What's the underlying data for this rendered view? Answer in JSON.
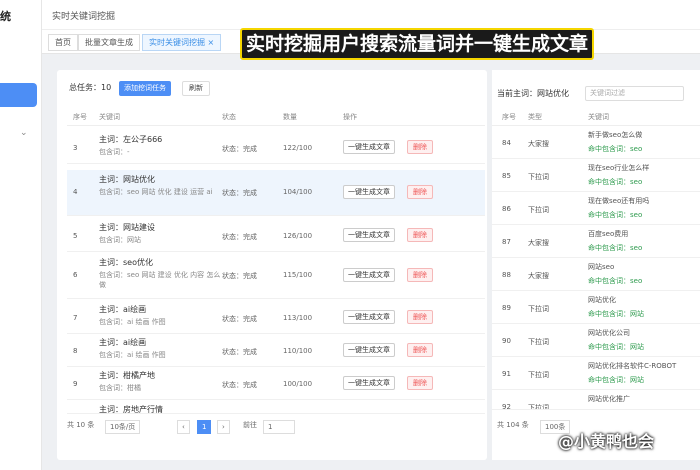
{
  "sidebar": {
    "brand": "统"
  },
  "topbar": {
    "breadcrumb": "实时关键词挖掘"
  },
  "tabs": [
    {
      "label": "首页"
    },
    {
      "label": "批量文章生成"
    },
    {
      "label": "实时关键词挖掘 ×"
    }
  ],
  "banner": "实时挖掘用户搜索流量词并一键生成文章",
  "left": {
    "total_label": "总任务：10",
    "add_button": "添加挖词任务",
    "refresh_button": "刷新",
    "headers": [
      "序号",
      "关键词",
      "状态",
      "数量",
      "操作"
    ],
    "rows": [
      {
        "seq": "3",
        "main": "主词：左公子666",
        "sub": "包含词：-",
        "status": "状态：完成",
        "count": "122/100"
      },
      {
        "seq": "4",
        "main": "主词：网站优化",
        "sub": "包含词：seo 网站 优化 建设 运营 ai",
        "status": "状态：完成",
        "count": "104/100"
      },
      {
        "seq": "5",
        "main": "主词：网站建设",
        "sub": "包含词：网站",
        "status": "状态：完成",
        "count": "126/100"
      },
      {
        "seq": "6",
        "main": "主词：seo优化",
        "sub": "包含词：seo 网站 建设 优化 内容 怎么做",
        "status": "状态：完成",
        "count": "115/100"
      },
      {
        "seq": "7",
        "main": "主词：ai绘画",
        "sub": "包含词：ai 绘画 作图",
        "status": "状态：完成",
        "count": "113/100"
      },
      {
        "seq": "8",
        "main": "主词：ai绘画",
        "sub": "包含词：ai 绘画 作图",
        "status": "状态：完成",
        "count": "110/100"
      },
      {
        "seq": "9",
        "main": "主词：柑橘产地",
        "sub": "包含词：柑橘",
        "status": "状态：完成",
        "count": "100/100"
      },
      {
        "seq": "",
        "main": "主词：房地产行情",
        "sub": "",
        "status": "",
        "count": ""
      }
    ],
    "gen_button": "一键生成文章",
    "del_button": "删除",
    "pager": {
      "total": "共 10 条",
      "per_page": "10条/页",
      "page": "1",
      "goto": "前往",
      "goto_value": "1"
    }
  },
  "right": {
    "current_label": "当前主词：网站优化",
    "filter_placeholder": "关键词过滤",
    "headers": [
      "序号",
      "类型",
      "关键词"
    ],
    "rows": [
      {
        "seq": "84",
        "type": "大家搜",
        "kw": "新手做seo怎么做",
        "hit": "命中包含词：seo"
      },
      {
        "seq": "85",
        "type": "下拉词",
        "kw": "现在seo行业怎么样",
        "hit": "命中包含词：seo"
      },
      {
        "seq": "86",
        "type": "下拉词",
        "kw": "现在做seo还有用吗",
        "hit": "命中包含词：seo"
      },
      {
        "seq": "87",
        "type": "大家搜",
        "kw": "百度seo费用",
        "hit": "命中包含词：seo"
      },
      {
        "seq": "88",
        "type": "大家搜",
        "kw": "网站seo",
        "hit": "命中包含词：seo"
      },
      {
        "seq": "89",
        "type": "下拉词",
        "kw": "网站优化",
        "hit": "命中包含词：网站"
      },
      {
        "seq": "90",
        "type": "下拉词",
        "kw": "网站优化公司",
        "hit": "命中包含词：网站"
      },
      {
        "seq": "91",
        "type": "下拉词",
        "kw": "网站优化排名软件C-ROBOT",
        "hit": "命中包含词：网站"
      },
      {
        "seq": "92",
        "type": "下拉词",
        "kw": "网站优化推广",
        "hit": ""
      }
    ],
    "pager": {
      "total": "共 104 条",
      "per_page": "100条"
    }
  },
  "watermark": "@小黄鸭也会"
}
